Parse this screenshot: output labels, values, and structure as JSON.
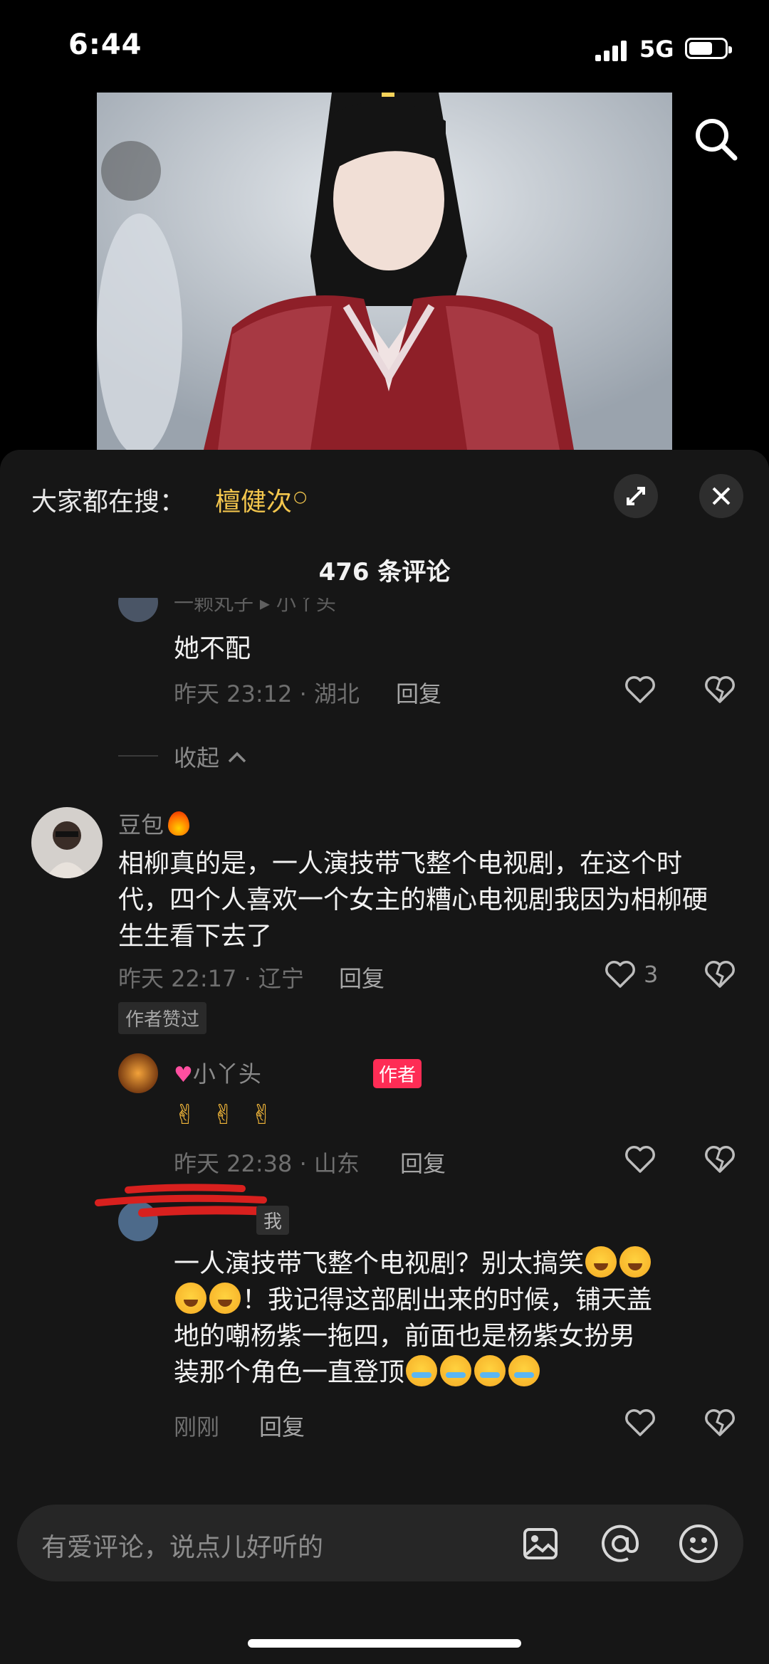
{
  "status_bar": {
    "time": "6:44",
    "network": "5G",
    "battery_level": 0.6
  },
  "search_bar": {
    "label": "大家都在搜：",
    "term": "檀健次"
  },
  "comments_header": {
    "count_text": "476 条评论"
  },
  "comments": {
    "reply_top": {
      "username_partial": "一颗丸子 ▸ 小丫头",
      "text": "她不配",
      "time": "昨天 23:12 · 湖北",
      "reply": "回复"
    },
    "collapse": "收起",
    "main": {
      "username": "豆包",
      "text": "相柳真的是，一人演技带飞整个电视剧，在这个时代，四个人喜欢一个女主的糟心电视剧我因为相柳硬生生看下去了",
      "time": "昨天 22:17 · 辽宁",
      "reply": "回复",
      "likes": "3",
      "author_liked": "作者赞过"
    },
    "author_reply": {
      "username": "小丫头",
      "author_badge": "作者",
      "time": "昨天 22:38 · 山东",
      "reply": "回复"
    },
    "my_reply": {
      "me_badge": "我",
      "text_line1": "一人演技带飞整个电视剧？别太搞笑",
      "text_line2": "！我记得这部剧出来的时候，铺天盖",
      "text_line3": "地的嘲杨紫一拖四，前面也是杨紫女扮男",
      "text_line4": "装那个角色一直登顶",
      "time": "刚刚",
      "reply": "回复"
    }
  },
  "input": {
    "placeholder": "有爱评论，说点儿好听的"
  },
  "colors": {
    "accent": "#fe2c55",
    "trend": "#f3c64d",
    "background": "#161616"
  }
}
